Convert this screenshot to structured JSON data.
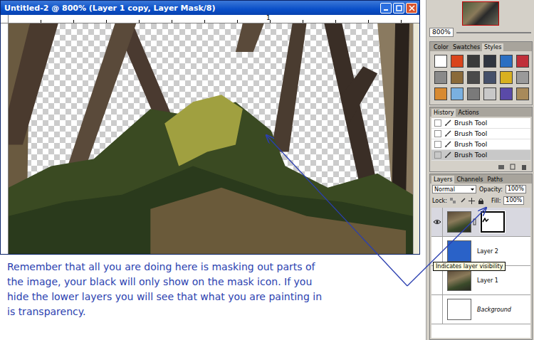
{
  "window": {
    "title": "Untitled-2 @ 800% (Layer 1 copy, Layer Mask/8)"
  },
  "ruler": {
    "labels": [
      "1"
    ]
  },
  "annotation": {
    "lines": [
      "Remember that all you are doing here is masking out parts of",
      "the image, your black will only show on the mask icon. If you",
      "hide the lower layers you will see that what you are painting in",
      "is transparency."
    ]
  },
  "navigator": {
    "zoom": "800%"
  },
  "styles_panel": {
    "tabs": [
      {
        "label": "Color",
        "selected": false
      },
      {
        "label": "Swatches",
        "selected": false
      },
      {
        "label": "Styles",
        "selected": true
      }
    ],
    "swatches": [
      {
        "color": "#ffffff"
      },
      {
        "color": "#d9441c"
      },
      {
        "color": "#3a3a3a"
      },
      {
        "color": "#2f3540"
      },
      {
        "color": "#2b6fc2"
      },
      {
        "color": "#c0303a"
      },
      {
        "color": "#8a8a8a"
      },
      {
        "color": "#8a6a3a"
      },
      {
        "color": "#4a4a4a"
      },
      {
        "color": "#45506a"
      },
      {
        "color": "#d8b020"
      },
      {
        "color": "#9a9a9a"
      },
      {
        "color": "#d88a30"
      },
      {
        "color": "#7ab0e0"
      },
      {
        "color": "#7a7a7a"
      },
      {
        "color": "#c8c8c8"
      },
      {
        "color": "#5a4aa8"
      },
      {
        "color": "#a88a5a"
      }
    ]
  },
  "history_panel": {
    "tabs": [
      {
        "label": "History",
        "selected": true
      },
      {
        "label": "Actions",
        "selected": false
      }
    ],
    "items": [
      {
        "label": "Brush Tool",
        "selected": false
      },
      {
        "label": "Brush Tool",
        "selected": false
      },
      {
        "label": "Brush Tool",
        "selected": false
      },
      {
        "label": "Brush Tool",
        "selected": true
      }
    ]
  },
  "layers_panel": {
    "tabs": [
      {
        "label": "Layers",
        "selected": true
      },
      {
        "label": "Channels",
        "selected": false
      },
      {
        "label": "Paths",
        "selected": false
      }
    ],
    "blend_mode": "Normal",
    "opacity_label": "Opacity:",
    "opacity": "100%",
    "lock_label": "Lock:",
    "fill_label": "Fill:",
    "fill": "100%",
    "layers": [
      {
        "name": "",
        "kind": "photo-mask",
        "visible": true,
        "selected": true,
        "locked": false
      },
      {
        "name": "Layer 2",
        "kind": "color",
        "color": "#2a62c8",
        "visible": false,
        "selected": false,
        "locked": false
      },
      {
        "name": "Layer 1",
        "kind": "photo",
        "visible": false,
        "selected": false,
        "locked": false
      },
      {
        "name": "Background",
        "kind": "blank",
        "visible": false,
        "selected": false,
        "locked": true
      }
    ],
    "tooltip": "Indicates layer visibility"
  }
}
